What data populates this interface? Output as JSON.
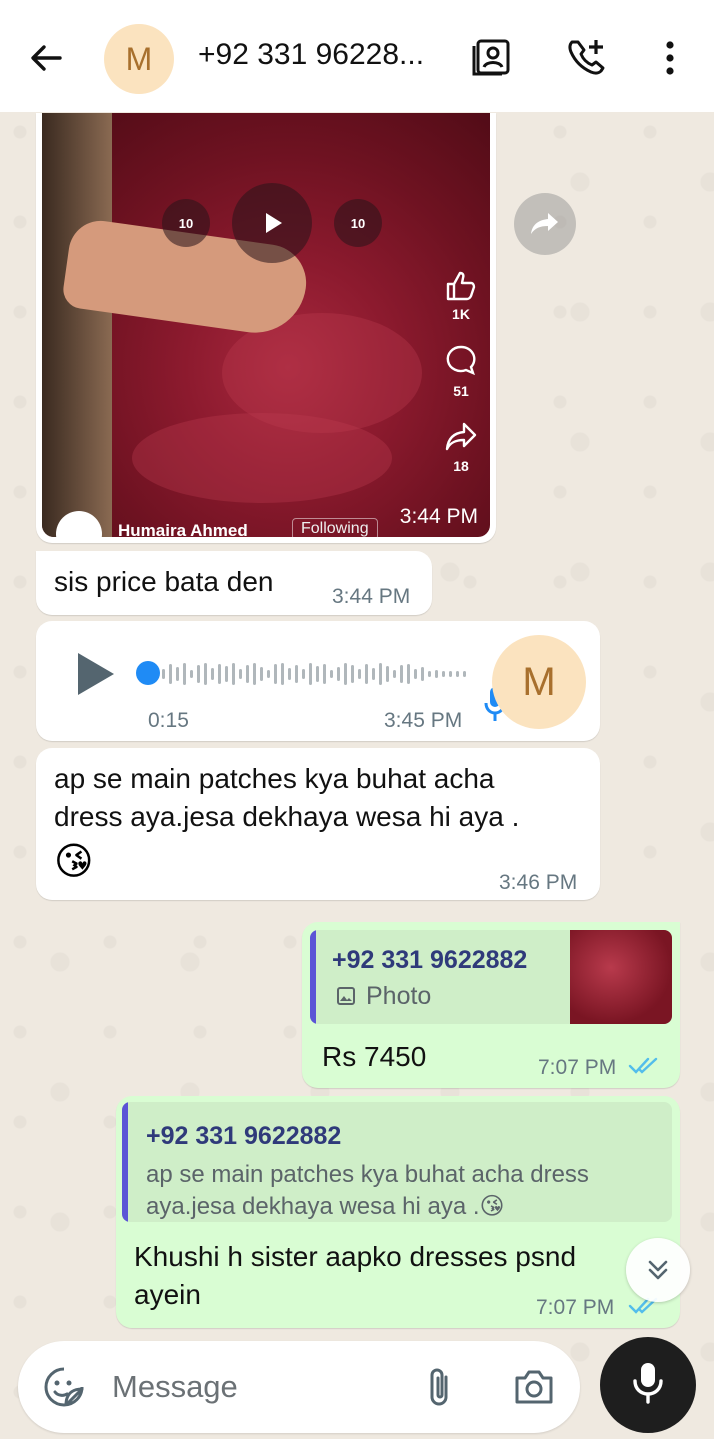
{
  "header": {
    "avatar_letter": "M",
    "contact_title": "+92 331 96228..."
  },
  "video": {
    "likes": "1K",
    "comments": "51",
    "shares": "18",
    "author": "Humaira Ahmed",
    "follow_label": "Following",
    "time": "3:44 PM",
    "skip_back": "10",
    "skip_fwd": "10"
  },
  "messages": {
    "m1": {
      "text": "sis price bata den",
      "time": "3:44 PM"
    },
    "voice": {
      "duration": "0:15",
      "time": "3:45 PM",
      "avatar_letter": "M"
    },
    "m3": {
      "line1": "ap se main patches kya buhat acha",
      "line2": "dress aya.jesa dekhaya wesa hi aya .",
      "emoji": "😘",
      "time": "3:46 PM"
    },
    "out1": {
      "quote_name": "+92 331 9622882",
      "quote_type": "Photo",
      "text": "Rs 7450",
      "time": "7:07 PM"
    },
    "out2": {
      "quote_name": "+92 331 9622882",
      "quote_line1": "ap se main patches kya buhat acha dress",
      "quote_line2": "aya.jesa dekhaya wesa hi aya .😘",
      "line1": "Khushi h sister aapko dresses psnd",
      "line2": "ayein",
      "time": "7:07 PM"
    }
  },
  "composer": {
    "placeholder": "Message"
  },
  "colors": {
    "outgoing": "#d9fdd3",
    "incoming": "#ffffff",
    "tick": "#53bdeb",
    "quote_bar": "#5b54d6"
  }
}
